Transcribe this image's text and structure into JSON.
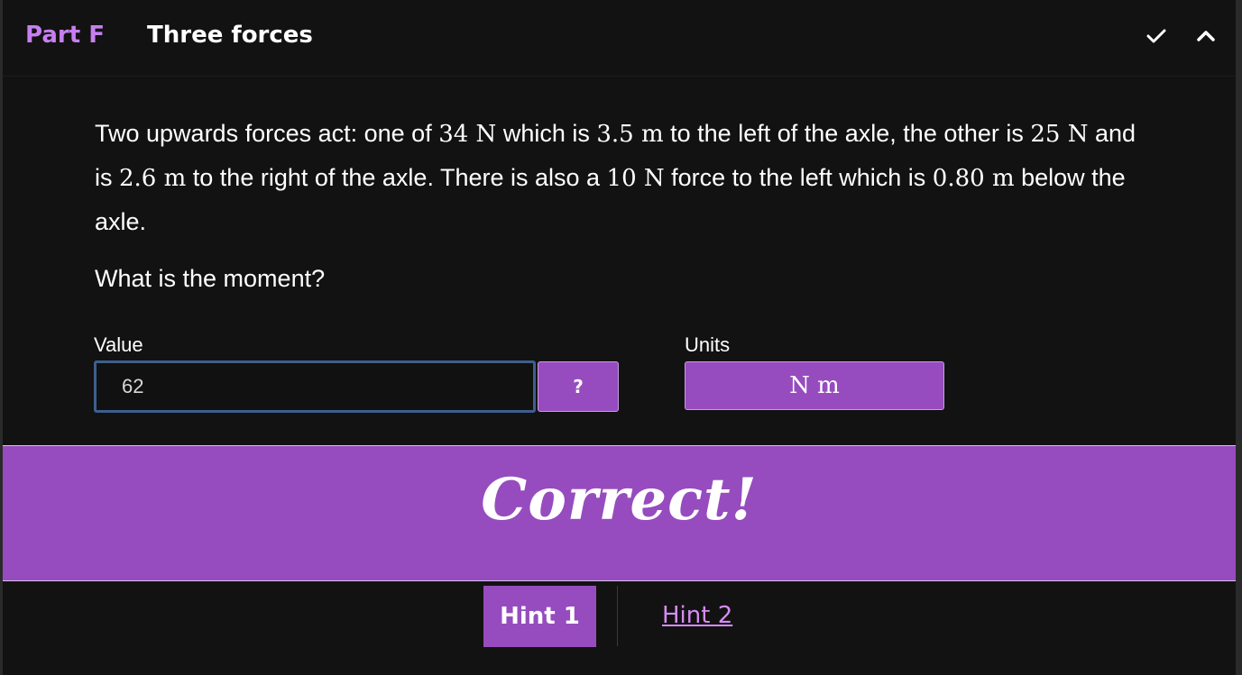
{
  "header": {
    "part_label": "Part F",
    "title": "Three forces",
    "icons": [
      "check-icon",
      "chevron-up-icon"
    ]
  },
  "question": {
    "seg1": "Two upwards forces act: one of ",
    "m1": "34 N",
    "seg2": " which is ",
    "m2": "3.5 m",
    "seg3": " to the left of the axle, the other is ",
    "m3": "25 N",
    "seg4": " and is ",
    "m4": "2.6 m",
    "seg5": " to the right of the axle. There is also a ",
    "m5": "10 N",
    "seg6": " force to the left which is ",
    "m6": "0.80 m",
    "seg7": " below the axle.",
    "prompt": "What is the moment?"
  },
  "answer": {
    "value_label": "Value",
    "value": "62",
    "help_label": "?",
    "units_label": "Units",
    "units_value": "N m"
  },
  "feedback": {
    "text": "Correct!"
  },
  "hints": {
    "hint1": "Hint 1",
    "hint2": "Hint 2"
  },
  "colors": {
    "accent": "#964cbe",
    "part_label": "#c77ff0",
    "link": "#d68cf5",
    "background": "#121212",
    "input_border": "#3e5f8e"
  }
}
